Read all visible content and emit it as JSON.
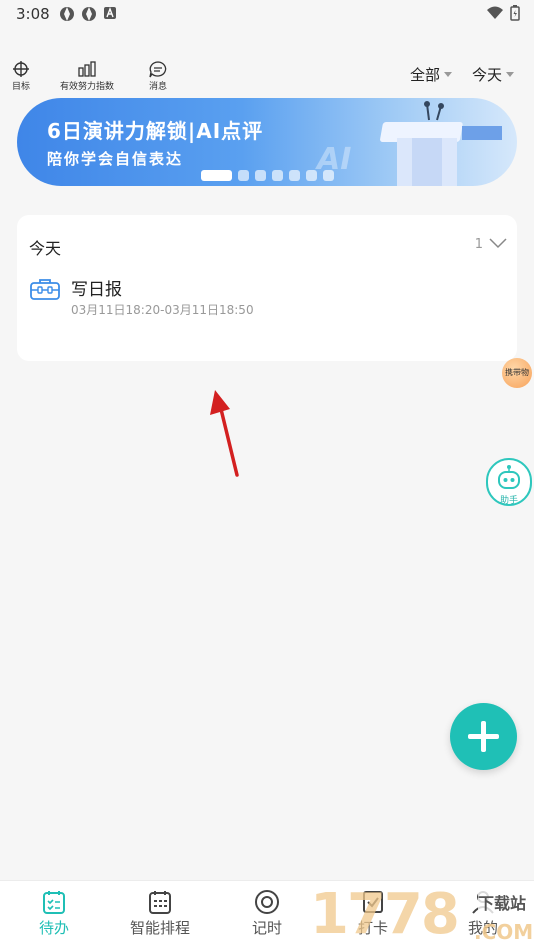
{
  "status": {
    "time": "3:08"
  },
  "topbar": {
    "target_label": "目标",
    "effort_label": "有效努力指数",
    "message_label": "消息",
    "filter_all": "全部",
    "filter_date": "今天"
  },
  "banner": {
    "title": "6日演讲力解锁|AI点评",
    "subtitle": "陪你学会自信表达",
    "watermark_text": "AI",
    "page_count": 7,
    "active_page": 1
  },
  "card": {
    "title": "今天",
    "count": "1",
    "task": {
      "title": "写日报",
      "time": "03月11日18:20-03月11日18:50"
    }
  },
  "floating": {
    "pill_label": "携带物",
    "assistant_label": "助手"
  },
  "tabs": [
    {
      "label": "待办",
      "active": true
    },
    {
      "label": "智能排程",
      "active": false
    },
    {
      "label": "记时",
      "active": false
    },
    {
      "label": "打卡",
      "active": false
    },
    {
      "label": "我的",
      "active": false
    }
  ],
  "watermark": {
    "text": "1778",
    "sub": "下载站",
    "url": ".COM"
  },
  "colors": {
    "accent": "#1fbfb5",
    "banner_start": "#3f86e8",
    "banner_end": "#d6e8fb"
  }
}
